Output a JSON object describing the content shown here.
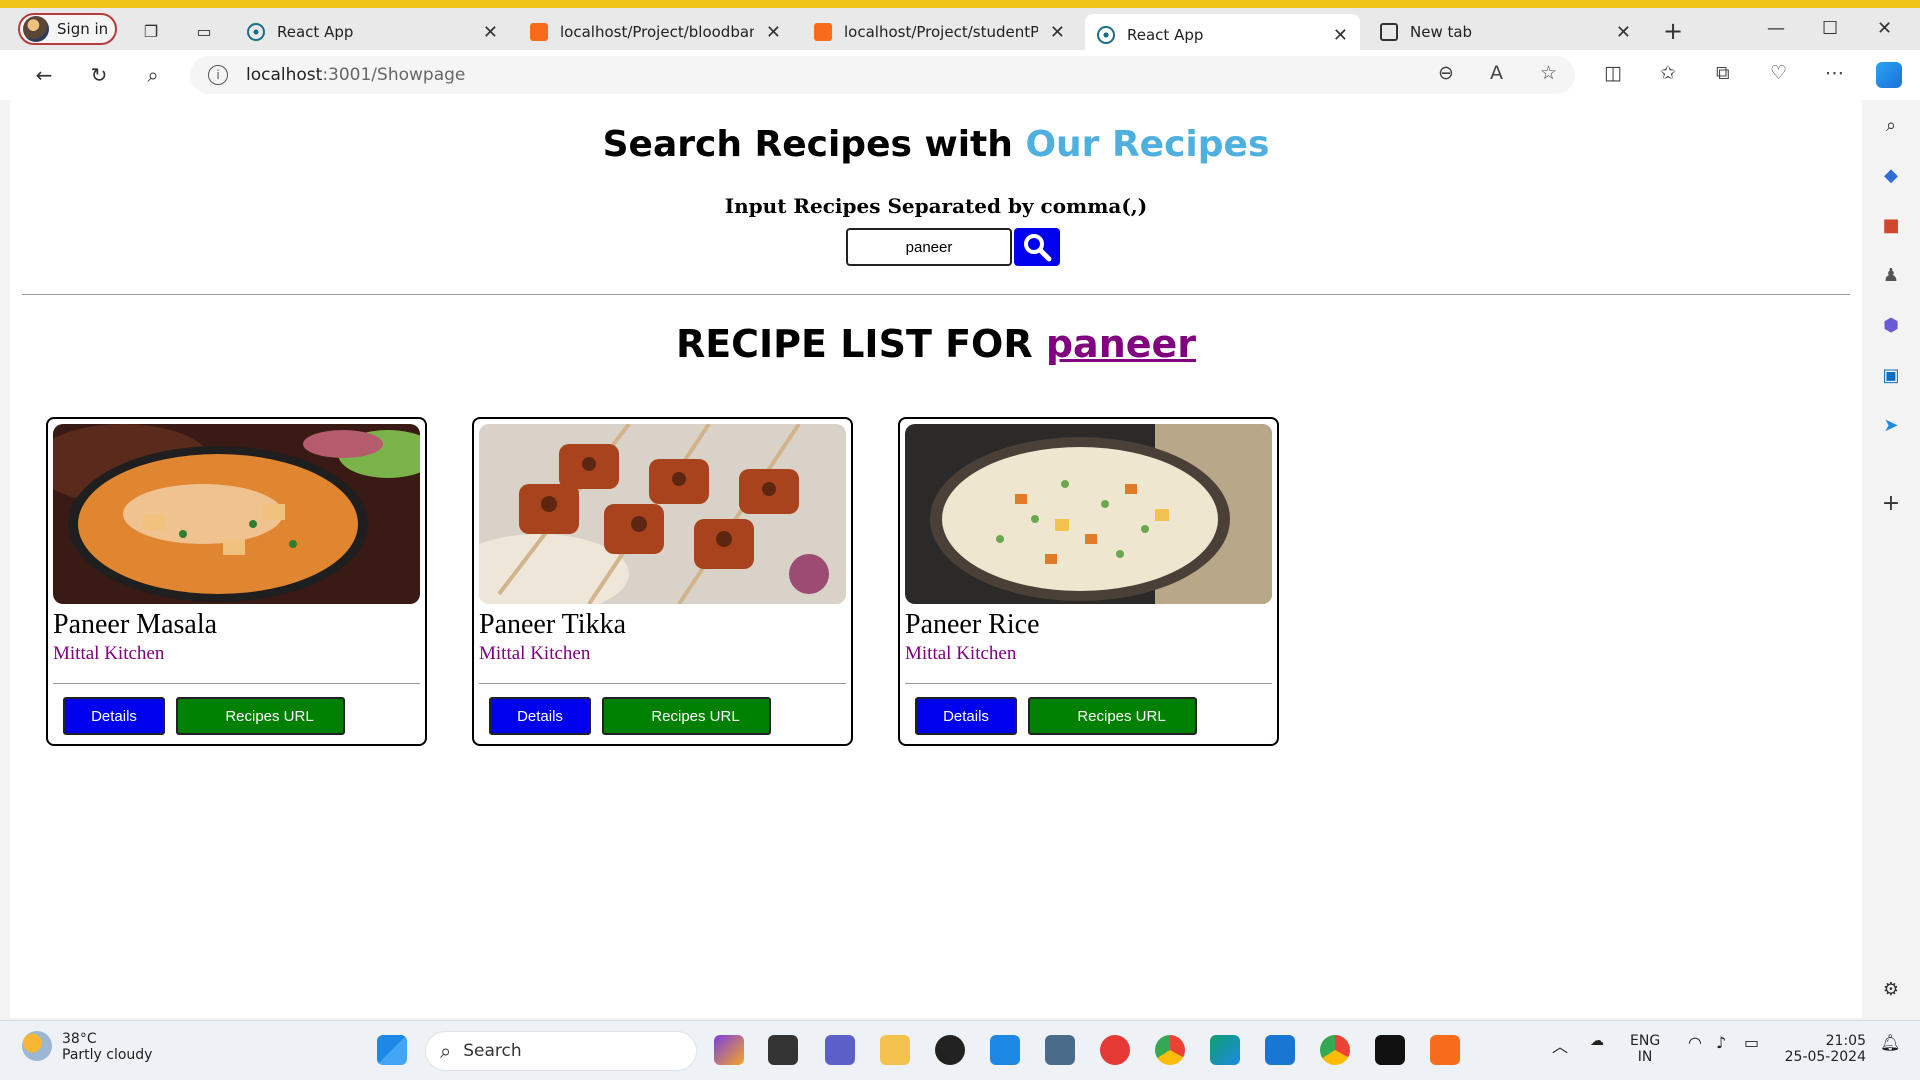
{
  "browser": {
    "signin_label": "Sign in",
    "tabs": [
      {
        "label": "React App",
        "favicon": "react-icon"
      },
      {
        "label": "localhost/Project/bloodbank/ir",
        "favicon": "xampp-icon"
      },
      {
        "label": "localhost/Project/studentPorta",
        "favicon": "xampp-icon"
      },
      {
        "label": "React App",
        "favicon": "react-icon",
        "active": true
      },
      {
        "label": "New tab",
        "favicon": "new-tab-icon"
      }
    ],
    "url_host": "localhost",
    "url_rest": ":3001/Showpage"
  },
  "page": {
    "heading_main": "Search Recipes with",
    "heading_accent": "Our Recipes",
    "input_label": "Input Recipes Separated by comma(,)",
    "search_value": "paneer",
    "list_title_prefix": "RECIPE LIST FOR",
    "list_title_query": "paneer",
    "accent_color": "#4fb0e0",
    "recipes": [
      {
        "name": "Paneer Masala",
        "source": "Mittal Kitchen",
        "details_label": "Details",
        "url_label": "Recipes URL"
      },
      {
        "name": "Paneer Tikka",
        "source": "Mittal Kitchen",
        "details_label": "Details",
        "url_label": "Recipes URL"
      },
      {
        "name": "Paneer Rice",
        "source": "Mittal Kitchen",
        "details_label": "Details",
        "url_label": "Recipes URL"
      }
    ]
  },
  "taskbar": {
    "temperature": "38°C",
    "weather": "Partly cloudy",
    "search_placeholder": "Search",
    "lang_top": "ENG",
    "lang_bottom": "IN",
    "time": "21:05",
    "date": "25-05-2024"
  }
}
